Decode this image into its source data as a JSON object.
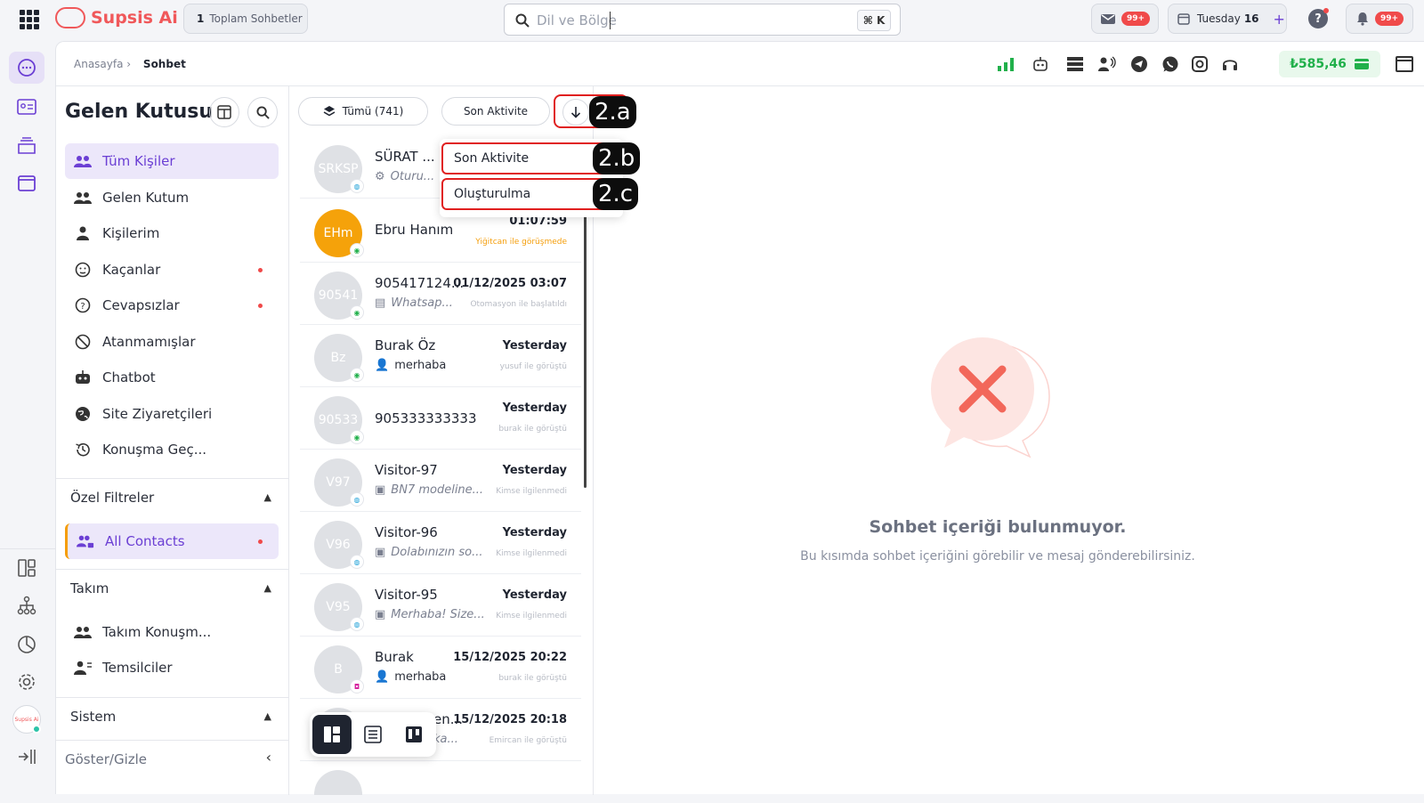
{
  "topbar": {
    "brand": "Supsis Ai",
    "conversations_count": "1",
    "conversations_label": "Toplam Sohbetler",
    "search_placeholder": "Dil ve Bölge",
    "shortcut": "⌘ K",
    "mail_badge": "99+",
    "day_name": "Tuesday",
    "day_number": "16",
    "notif_badge": "99+"
  },
  "subheader": {
    "breadcrumb_home": "Anasayfa",
    "breadcrumb_sep": "›",
    "breadcrumb_current": "Sohbet",
    "balance": "₺585,46"
  },
  "inbox": {
    "title": "Gelen Kutusu",
    "items": [
      {
        "label": "Tüm Kişiler"
      },
      {
        "label": "Gelen Kutum"
      },
      {
        "label": "Kişilerim"
      },
      {
        "label": "Kaçanlar"
      },
      {
        "label": "Cevapsızlar"
      },
      {
        "label": "Atanmamışlar"
      },
      {
        "label": "Chatbot"
      },
      {
        "label": "Site Ziyaretçileri"
      },
      {
        "label": "Konuşma Geç..."
      }
    ],
    "special_filters": "Özel Filtreler",
    "all_contacts": "All Contacts",
    "team": "Takım",
    "team_items": [
      {
        "label": "Takım Konuşm..."
      },
      {
        "label": "Temsilciler"
      }
    ],
    "system": "Sistem",
    "toggle": "Göster/Gizle"
  },
  "list": {
    "filter_all": "Tümü (741)",
    "sort_label": "Son Aktivite",
    "dropdown": [
      "Son Aktivite",
      "Oluşturulma"
    ],
    "callouts": [
      "2.a",
      "2.b",
      "2.c"
    ],
    "rows": [
      {
        "avatar": "SRKSP",
        "name": "SÜRAT ...",
        "sub": "Oturu...",
        "time": "",
        "status": ""
      },
      {
        "avatar": "EHm",
        "name": "Ebru Hanım",
        "sub": "",
        "time": "01:07:59",
        "status": "Yiğitcan ile görüşmede"
      },
      {
        "avatar": "90541",
        "name": "905417124...",
        "sub": "Whatsap...",
        "time": "01/12/2025 03:07",
        "status": "Otomasyon ile başlatıldı"
      },
      {
        "avatar": "Bz",
        "name": "Burak Öz",
        "sub": "merhaba",
        "time": "Yesterday",
        "status": "yusuf ile görüştü"
      },
      {
        "avatar": "90533",
        "name": "905333333333",
        "sub": "",
        "time": "Yesterday",
        "status": "burak ile görüştü"
      },
      {
        "avatar": "V97",
        "name": "Visitor-97",
        "sub": "BN7 modeline...",
        "time": "Yesterday",
        "status": "Kimse ilgilenmedi"
      },
      {
        "avatar": "V96",
        "name": "Visitor-96",
        "sub": "Dolabınızın so...",
        "time": "Yesterday",
        "status": "Kimse ilgilenmedi"
      },
      {
        "avatar": "V95",
        "name": "Visitor-95",
        "sub": "Merhaba! Size...",
        "time": "Yesterday",
        "status": "Kimse ilgilenmedi"
      },
      {
        "avatar": "B",
        "name": "Burak",
        "sub": "merhaba",
        "time": "15/12/2025 20:22",
        "status": "burak ile görüştü"
      },
      {
        "avatar": "",
        "name": "en...",
        "sub": "ka...",
        "time": "15/12/2025 20:18",
        "status": "Emircan ile görüştü"
      }
    ]
  },
  "empty": {
    "title": "Sohbet içeriği bulunmuyor.",
    "description": "Bu kısımda sohbet içeriğini görebilir ve mesaj gönderebilirsiniz."
  },
  "colors": {
    "accent": "#6b3fd4",
    "brand": "#f0585a",
    "success": "#21b04b",
    "alert": "#f04a4a",
    "highlight": "#e01f1f"
  }
}
